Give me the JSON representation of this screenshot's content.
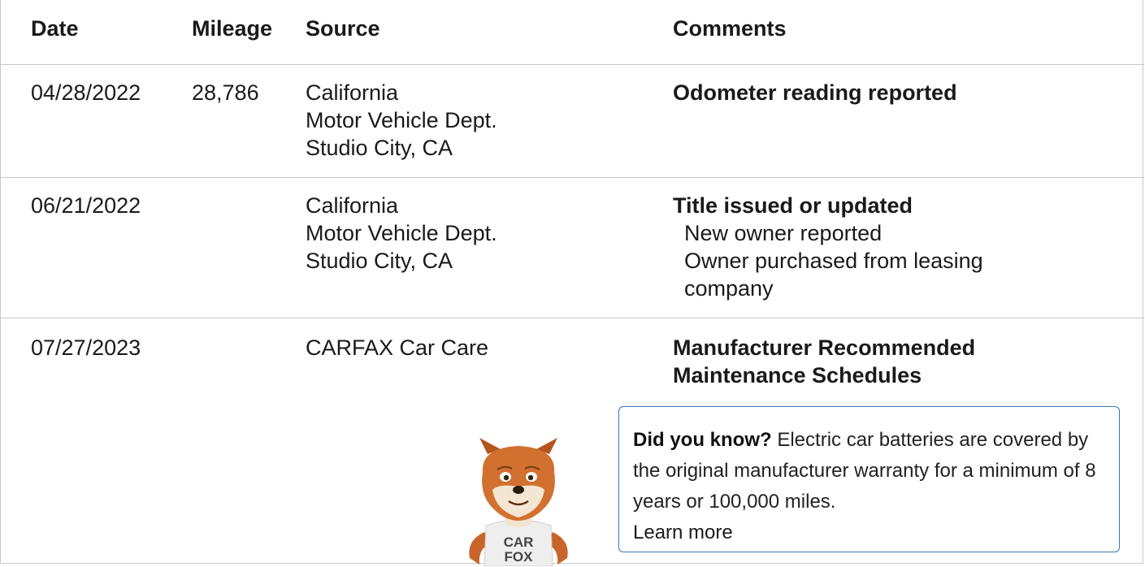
{
  "table": {
    "headers": {
      "date": "Date",
      "mileage": "Mileage",
      "source": "Source",
      "comments": "Comments"
    },
    "rows": [
      {
        "date": "04/28/2022",
        "mileage": "28,786",
        "source": [
          "California",
          "Motor Vehicle Dept.",
          "Studio City, CA"
        ],
        "comment_title": "Odometer reading reported",
        "comment_lines": []
      },
      {
        "date": "06/21/2022",
        "mileage": "",
        "source": [
          "California",
          "Motor Vehicle Dept.",
          "Studio City, CA"
        ],
        "comment_title": "Title issued or updated",
        "comment_lines": [
          "New owner reported",
          "Owner purchased from leasing company"
        ]
      },
      {
        "date": "07/27/2023",
        "mileage": "",
        "source": [
          "CARFAX Car Care"
        ],
        "comment_title": "Manufacturer Recommended Maintenance Schedules",
        "comment_lines": []
      }
    ]
  },
  "tip": {
    "lead": "Did you know?",
    "body": "Electric car batteries are covered by the original manufacturer warranty for a minimum of 8 years or 100,000 miles.",
    "link": "Learn more"
  },
  "mascot": {
    "shirt_line1": "CAR",
    "shirt_line2": "FOX",
    "icon": "carfox-mascot-icon"
  },
  "colors": {
    "tip_border": "#3777bc",
    "rule": "#c8c8c8"
  }
}
